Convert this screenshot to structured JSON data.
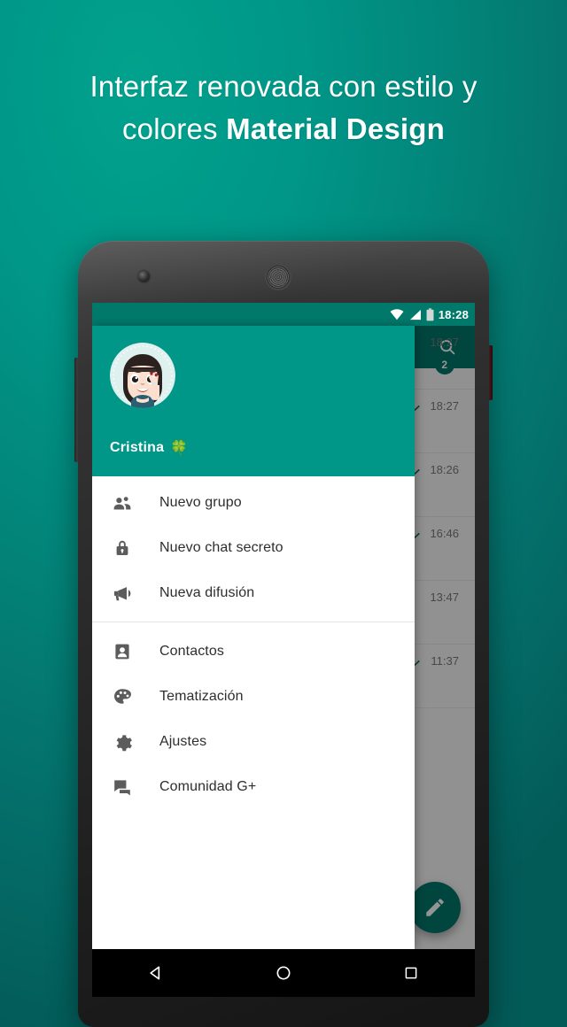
{
  "promo": {
    "headline_line1": "Interfaz renovada con estilo y",
    "headline_line2_plain": "colores ",
    "headline_line2_strong": "Material Design"
  },
  "status_bar": {
    "clock": "18:28",
    "icons": [
      "wifi-icon",
      "signal-icon",
      "battery-icon"
    ]
  },
  "toolbar": {
    "search_icon": "search-icon"
  },
  "drawer": {
    "profile": {
      "name": "Cristina",
      "emoji": "🍀",
      "avatar": "user-avatar"
    },
    "group1": [
      {
        "label": "Nuevo grupo",
        "icon": "people-icon"
      },
      {
        "label": "Nuevo chat secreto",
        "icon": "lock-icon"
      },
      {
        "label": "Nueva difusión",
        "icon": "megaphone-icon"
      }
    ],
    "group2": [
      {
        "label": "Contactos",
        "icon": "contact-card-icon"
      },
      {
        "label": "Tematización",
        "icon": "palette-icon"
      },
      {
        "label": "Ajustes",
        "icon": "gear-icon"
      },
      {
        "label": "Comunidad G+",
        "icon": "chat-bubbles-icon"
      }
    ]
  },
  "chat_list": {
    "rows": [
      {
        "time": "18:27",
        "badge": "2",
        "tick": false
      },
      {
        "time": "18:27",
        "badge": "",
        "tick": true
      },
      {
        "time": "18:26",
        "badge": "",
        "tick": true
      },
      {
        "time": "16:46",
        "badge": "",
        "tick": true
      },
      {
        "time": "13:47",
        "badge": "",
        "tick": false
      },
      {
        "time": "11:37",
        "badge": "",
        "tick": true
      }
    ],
    "fab_icon": "pencil-edit-icon"
  },
  "nav_bar": {
    "back": "back-triangle-icon",
    "home": "home-circle-icon",
    "recents": "recents-square-icon"
  },
  "colors": {
    "background_top": "#009688",
    "background_bottom": "#035b58",
    "primary": "#009688",
    "primary_dark": "#00796B",
    "drawer_bg": "#ffffff"
  }
}
